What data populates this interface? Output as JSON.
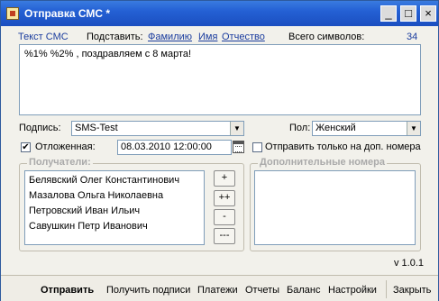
{
  "window": {
    "title": "Отправка СМС *"
  },
  "titlebar_buttons": {
    "minimize": "_",
    "maximize": "□",
    "close": "×"
  },
  "sms": {
    "label": "Текст СМС",
    "insert_label": "Подставить:",
    "links": [
      "Фамилию",
      "Имя",
      "Отчество"
    ],
    "total_label": "Всего символов:",
    "total_count": "34",
    "text": "%1% %2% , поздравляем с 8 марта!"
  },
  "signature": {
    "label": "Подпись:",
    "value": "SMS-Test"
  },
  "gender": {
    "label": "Пол:",
    "value": "Женский"
  },
  "deferred": {
    "label": "Отложенная:",
    "checked": true,
    "datetime": "08.03.2010 12:00:00"
  },
  "extra_only": {
    "label": "Отправить только на доп. номера",
    "checked": false
  },
  "recipients": {
    "title": "Получатели:",
    "items": [
      "Белявский Олег Константинович",
      "Мазалова Ольга Николаевна",
      "Петровский Иван Ильич",
      "Савушкин Петр Иванович"
    ],
    "buttons": [
      "+",
      "++",
      "-",
      "---"
    ]
  },
  "extra_numbers": {
    "title": "Дополнительные номера"
  },
  "version": "v 1.0.1",
  "actions": {
    "send": "Отправить",
    "get_signatures": "Получить подписи",
    "payments": "Платежи",
    "reports": "Отчеты",
    "balance": "Баланс",
    "settings": "Настройки",
    "close": "Закрыть"
  }
}
